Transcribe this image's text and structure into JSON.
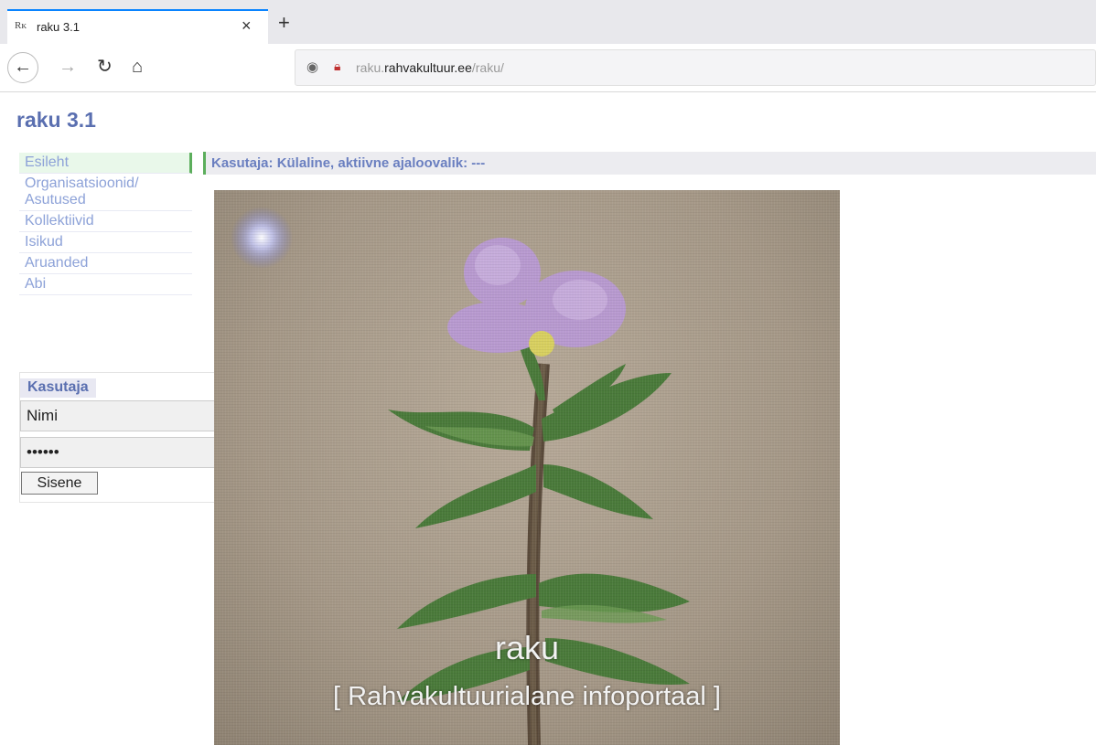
{
  "browser": {
    "tab_title": "raku 3.1",
    "tab_favicon": "Rᴋ",
    "url_subdomain": "raku.",
    "url_domain": "rahvakultuur.ee",
    "url_path": "/raku/"
  },
  "site": {
    "title": "raku 3.1"
  },
  "nav": {
    "items": [
      {
        "label": "Esileht"
      },
      {
        "label": "Organisatsioonid/ Asutused"
      },
      {
        "label": "Kollektiivid"
      },
      {
        "label": "Isikud"
      },
      {
        "label": "Aruanded"
      },
      {
        "label": "Abi"
      }
    ]
  },
  "login": {
    "header": "Kasutaja",
    "name_value": "Nimi",
    "password_value": "••••••",
    "submit_label": "Sisene"
  },
  "status": {
    "text": "Kasutaja: Külaline, aktiivne ajaloovalik: ---"
  },
  "hero": {
    "title": "raku",
    "subtitle": "[ Rahvakultuurialane infoportaal ]"
  },
  "colors": {
    "accent": "#5a6fb0",
    "nav_link": "#8da2d8",
    "active_bg": "#e9f8ea",
    "active_border": "#5cae5c"
  }
}
